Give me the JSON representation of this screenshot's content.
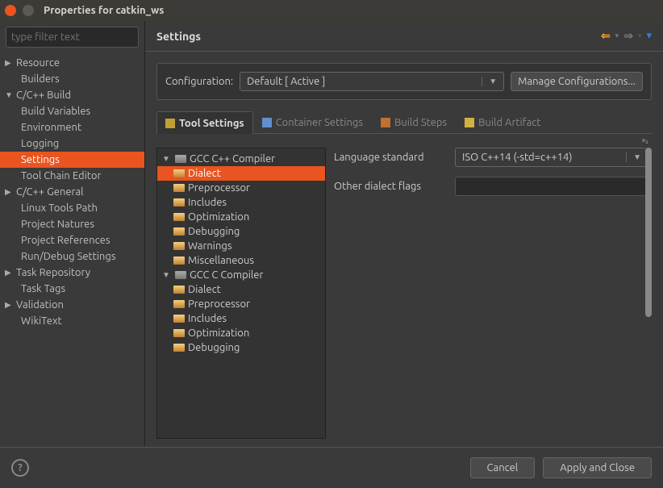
{
  "window": {
    "title": "Properties for catkin_ws"
  },
  "filter": {
    "placeholder": "type filter text"
  },
  "sidebar": [
    {
      "label": "Resource",
      "arrow": "▶",
      "level": 0
    },
    {
      "label": "Builders",
      "arrow": "",
      "level": 1
    },
    {
      "label": "C/C++ Build",
      "arrow": "▼",
      "level": 0
    },
    {
      "label": "Build Variables",
      "arrow": "",
      "level": 1
    },
    {
      "label": "Environment",
      "arrow": "",
      "level": 1
    },
    {
      "label": "Logging",
      "arrow": "",
      "level": 1
    },
    {
      "label": "Settings",
      "arrow": "",
      "level": 1,
      "selected": true
    },
    {
      "label": "Tool Chain Editor",
      "arrow": "",
      "level": 1
    },
    {
      "label": "C/C++ General",
      "arrow": "▶",
      "level": 0
    },
    {
      "label": "Linux Tools Path",
      "arrow": "",
      "level": 1
    },
    {
      "label": "Project Natures",
      "arrow": "",
      "level": 1
    },
    {
      "label": "Project References",
      "arrow": "",
      "level": 1
    },
    {
      "label": "Run/Debug Settings",
      "arrow": "",
      "level": 1
    },
    {
      "label": "Task Repository",
      "arrow": "▶",
      "level": 0
    },
    {
      "label": "Task Tags",
      "arrow": "",
      "level": 1
    },
    {
      "label": "Validation",
      "arrow": "▶",
      "level": 0
    },
    {
      "label": "WikiText",
      "arrow": "",
      "level": 1
    }
  ],
  "content": {
    "heading": "Settings",
    "config_label": "Configuration:",
    "config_value": "Default  [ Active ]",
    "manage_btn": "Manage Configurations...",
    "tabs": [
      {
        "label": "Tool Settings",
        "active": true
      },
      {
        "label": "Container Settings"
      },
      {
        "label": "Build Steps"
      },
      {
        "label": "Build Artifact"
      }
    ],
    "sub_indicator": "»₂",
    "tool_tree": [
      {
        "label": "GCC C++ Compiler",
        "arrow": "▼",
        "level": 0,
        "kind": "comp"
      },
      {
        "label": "Dialect",
        "level": 1,
        "selected": true
      },
      {
        "label": "Preprocessor",
        "level": 1
      },
      {
        "label": "Includes",
        "level": 1
      },
      {
        "label": "Optimization",
        "level": 1
      },
      {
        "label": "Debugging",
        "level": 1
      },
      {
        "label": "Warnings",
        "level": 1
      },
      {
        "label": "Miscellaneous",
        "level": 1
      },
      {
        "label": "GCC C Compiler",
        "arrow": "▼",
        "level": 0,
        "kind": "comp"
      },
      {
        "label": "Dialect",
        "level": 1
      },
      {
        "label": "Preprocessor",
        "level": 1
      },
      {
        "label": "Includes",
        "level": 1
      },
      {
        "label": "Optimization",
        "level": 1
      },
      {
        "label": "Debugging",
        "level": 1
      }
    ],
    "form": {
      "lang_std_label": "Language standard",
      "lang_std_value": "ISO C++14 (-std=c++14)",
      "other_flags_label": "Other dialect flags",
      "other_flags_value": ""
    }
  },
  "buttons": {
    "help": "?",
    "cancel": "Cancel",
    "apply": "Apply and Close"
  }
}
